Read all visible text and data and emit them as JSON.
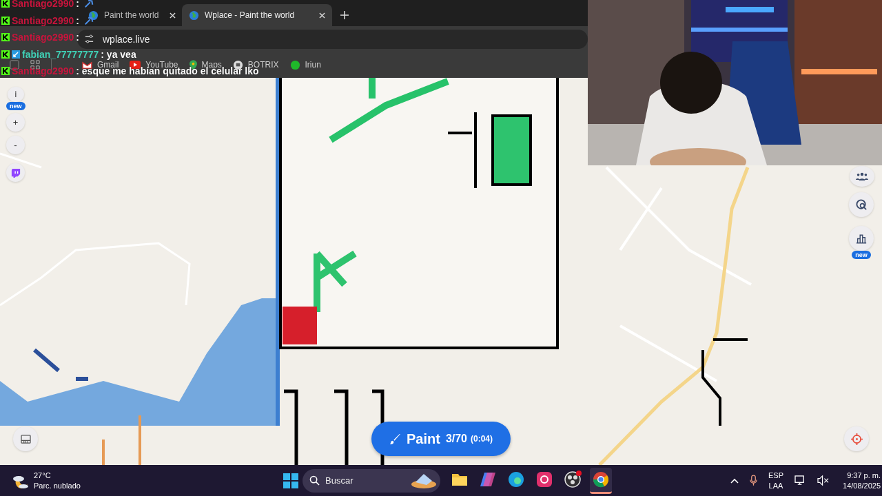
{
  "browser": {
    "tabs": [
      {
        "title": "Paint the world",
        "selected": false
      },
      {
        "title": "Wplace - Paint the world",
        "selected": true
      }
    ],
    "address": "wplace.live",
    "bookmarks": [
      {
        "label": "Gmail",
        "kind": "gmail"
      },
      {
        "label": "YouTube",
        "kind": "youtube"
      },
      {
        "label": "Maps",
        "kind": "maps"
      },
      {
        "label": "BOTRIX",
        "kind": "botrix"
      },
      {
        "label": "Iriun",
        "kind": "iriun"
      }
    ]
  },
  "chat": [
    {
      "user": "Santiago2990",
      "text": ":",
      "color": "#c8143c",
      "extra_badge": false,
      "emote": true
    },
    {
      "user": "Santiago2990",
      "text": ":",
      "color": "#c8143c",
      "extra_badge": false,
      "emote": true
    },
    {
      "user": "Santiago2990",
      "text": ":",
      "color": "#c8143c",
      "extra_badge": false,
      "emote": false
    },
    {
      "user": "fabian_77777777",
      "text": ": ya vea",
      "color": "#3fd0b5",
      "extra_badge": true,
      "emote": false
    },
    {
      "user": "Santiago2990",
      "text": ": esque me habían quitado el celular lko",
      "color": "#c8143c",
      "extra_badge": false,
      "emote": false
    }
  ],
  "map_controls": {
    "info_label": "i",
    "info_badge": "new",
    "zoom_in": "+",
    "zoom_out": "-",
    "stats_badge": "new"
  },
  "paint_button": {
    "label": "Paint",
    "charges": "3/70",
    "timer": "(0:04)"
  },
  "taskbar": {
    "weather": {
      "temperature": "27°C",
      "condition": "Parc. nublado"
    },
    "search": {
      "placeholder": "Buscar"
    },
    "apps": [
      {
        "kind": "files",
        "selected": false,
        "notification": false
      },
      {
        "kind": "copilot",
        "selected": false,
        "notification": false
      },
      {
        "kind": "edge",
        "selected": false,
        "notification": false
      },
      {
        "kind": "instagram",
        "selected": false,
        "notification": false
      },
      {
        "kind": "obs",
        "selected": false,
        "notification": true
      },
      {
        "kind": "chrome",
        "selected": true,
        "notification": false
      }
    ],
    "language": [
      "ESP",
      "LAA"
    ],
    "time": "9:37 p. m.",
    "date": "14/08/2025"
  }
}
